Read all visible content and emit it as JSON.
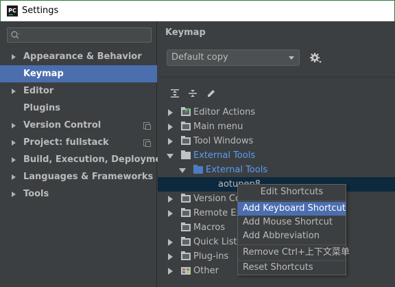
{
  "window": {
    "app_icon_text": "PC",
    "title": "Settings"
  },
  "sidebar": {
    "search_placeholder": "",
    "items": [
      {
        "label": "Appearance & Behavior",
        "expandable": true,
        "selected": false
      },
      {
        "label": "Keymap",
        "expandable": false,
        "selected": true
      },
      {
        "label": "Editor",
        "expandable": true,
        "selected": false
      },
      {
        "label": "Plugins",
        "expandable": false,
        "selected": false
      },
      {
        "label": "Version Control",
        "expandable": true,
        "selected": false,
        "project_icon": "copy-icon"
      },
      {
        "label": "Project: fullstack",
        "expandable": true,
        "selected": false,
        "project_icon": "copy-icon"
      },
      {
        "label": "Build, Execution, Deployment",
        "expandable": true,
        "selected": false
      },
      {
        "label": "Languages & Frameworks",
        "expandable": true,
        "selected": false
      },
      {
        "label": "Tools",
        "expandable": true,
        "selected": false
      }
    ]
  },
  "main": {
    "heading": "Keymap",
    "keymap_select": {
      "value": "Default copy"
    },
    "toolbar_icons": [
      "expand-all-icon",
      "collapse-all-icon",
      "edit-icon"
    ],
    "tree": [
      {
        "label": "Editor Actions",
        "expanded": false,
        "icon": "editor-actions-icon"
      },
      {
        "label": "Main menu",
        "expanded": false,
        "icon": "main-menu-icon"
      },
      {
        "label": "Tool Windows",
        "expanded": false,
        "icon": "folder-icon"
      },
      {
        "label": "External Tools",
        "expanded": true,
        "icon": "folder-icon",
        "color": "blue"
      },
      {
        "label": "External Tools",
        "expanded": true,
        "icon": "folder-icon",
        "color": "blue",
        "level": 1
      },
      {
        "label": "aotupep8",
        "level": 2,
        "selected": true
      },
      {
        "label": "Version Co",
        "expanded": false,
        "icon": "folder-icon"
      },
      {
        "label": "Remote Ext",
        "expanded": false,
        "icon": "folder-icon"
      },
      {
        "label": "Macros",
        "expanded": false,
        "icon": "folder-icon",
        "leaf": true
      },
      {
        "label": "Quick Lists",
        "expanded": false,
        "icon": "folder-icon"
      },
      {
        "label": "Plug-ins",
        "expanded": false,
        "icon": "folder-icon"
      },
      {
        "label": "Other",
        "expanded": false,
        "icon": "other-icon"
      }
    ]
  },
  "context_menu": {
    "title": "Edit Shortcuts",
    "items": [
      {
        "label": "Add Keyboard Shortcut",
        "active": true
      },
      {
        "label": "Add Mouse Shortcut",
        "active": false
      },
      {
        "label": "Add Abbreviation",
        "active": false
      },
      {
        "label": "Remove Ctrl+上下文菜单",
        "active": false
      },
      {
        "label": "Reset Shortcuts",
        "active": false
      }
    ]
  },
  "colors": {
    "selection": "#4b6eaf",
    "link_blue": "#589df6",
    "background": "#3c3f41"
  }
}
